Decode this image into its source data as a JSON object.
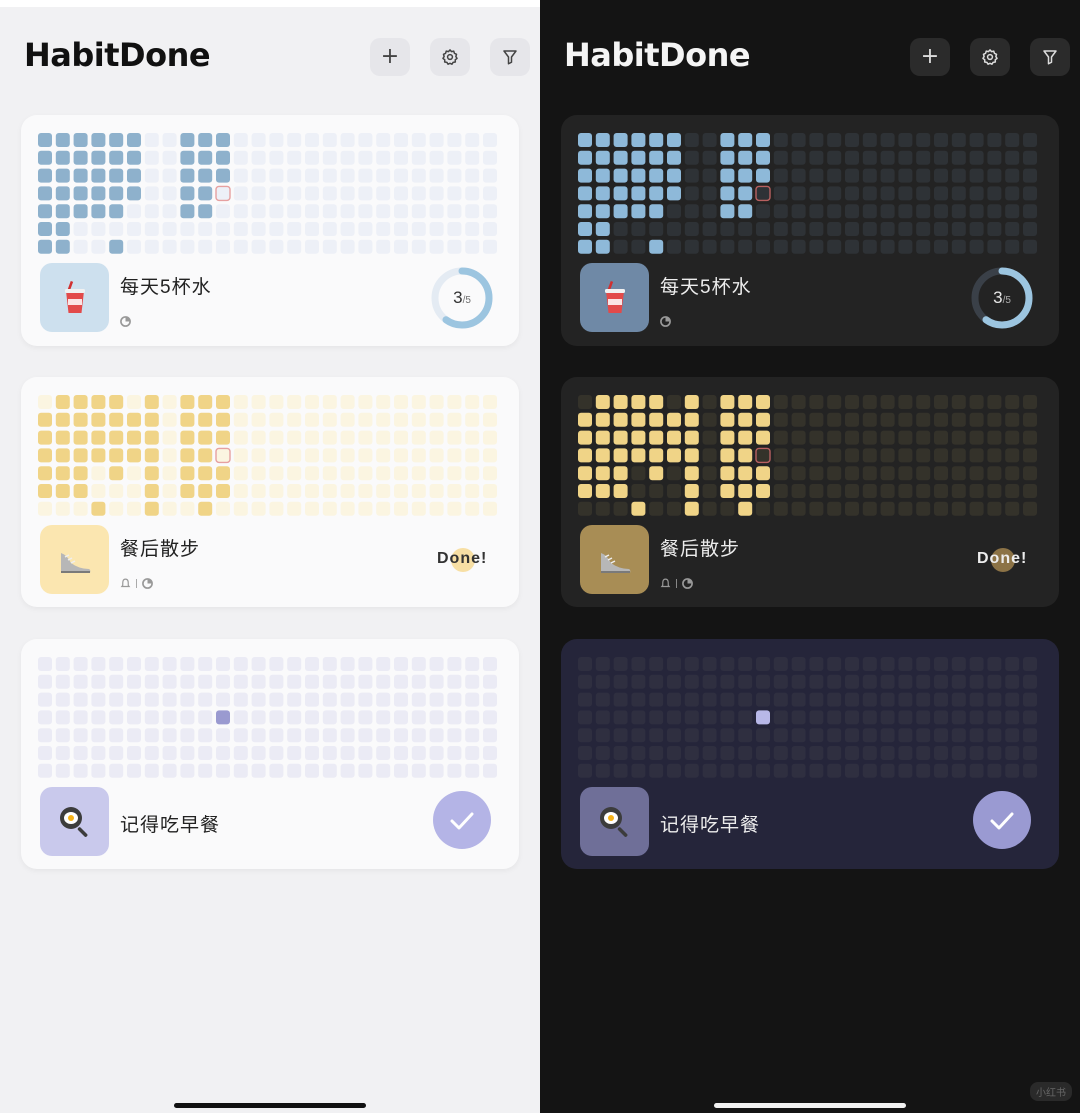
{
  "app": {
    "title": "HabitDone"
  },
  "toolbar": {
    "add_symbol": "+",
    "add_icon": "plus-icon",
    "settings_icon": "gear-icon",
    "filter_icon": "filter-icon"
  },
  "themes": [
    {
      "name": "light",
      "colors": {
        "background": "#f1f1f3",
        "card": "#fafafb",
        "blue_on": "#8eb1cc",
        "blue_off": "#edf0f7",
        "yellow_on": "#f0d487",
        "yellow_off": "#fbf5e1",
        "lav_off": "#ebebf5",
        "today_border": "#e6a0a0",
        "lav_today": "#9a9ad0"
      }
    },
    {
      "name": "dark",
      "colors": {
        "background": "#141414",
        "card": "#232323",
        "blue_on": "#8eb9d9",
        "blue_off": "#2e3236",
        "yellow_on": "#f0d487",
        "yellow_off": "#34322a",
        "lav_off": "#2f2f40",
        "today_border": "#b86060",
        "lav_today": "#b8b8e8"
      }
    }
  ],
  "habits": [
    {
      "name": "每天5杯水",
      "icon": "drink-cup-icon",
      "icon_bg_light": "#cde0ee",
      "icon_bg_dark": "#6f89a6",
      "meta_icons": [
        "progress-icon"
      ],
      "status": "progress",
      "progress": {
        "current": "3",
        "total": "/5",
        "fraction": 0.6
      },
      "ring_color": "#9cc5e0",
      "ring_track_light": "#e4ebf3",
      "ring_track_dark": "#3a4048",
      "palette": "blue"
    },
    {
      "name": "餐后散步",
      "icon": "sneaker-icon",
      "icon_bg_light": "#fbe6b0",
      "icon_bg_dark": "#a88d55",
      "meta_icons": [
        "bell-icon",
        "progress-icon"
      ],
      "status": "done",
      "done_label": "Done!",
      "palette": "yellow"
    },
    {
      "name": "记得吃早餐",
      "icon": "frying-pan-egg-icon",
      "icon_bg_light": "#c9c9ec",
      "icon_bg_dark": "#6f6f98",
      "meta_icons": [],
      "status": "check",
      "check_icon": "checkmark-icon",
      "palette": "lavender"
    }
  ],
  "footer": {
    "watermark": "小红书"
  }
}
